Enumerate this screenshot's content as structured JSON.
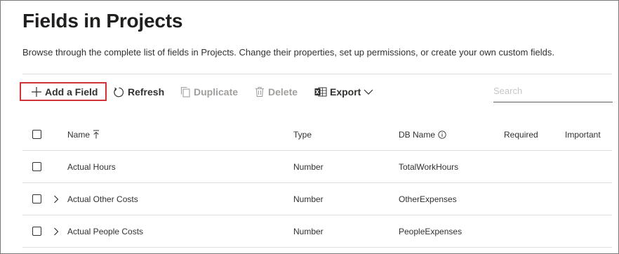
{
  "page": {
    "title": "Fields in Projects",
    "description": "Browse through the complete list of fields in Projects. Change their properties, set up permissions, or create your own custom fields."
  },
  "toolbar": {
    "add_label": "Add a Field",
    "refresh_label": "Refresh",
    "duplicate_label": "Duplicate",
    "delete_label": "Delete",
    "export_label": "Export",
    "search_placeholder": "Search"
  },
  "table": {
    "columns": {
      "name": "Name",
      "type": "Type",
      "db_name": "DB Name",
      "required": "Required",
      "important": "Important"
    },
    "rows": [
      {
        "name": "Actual Hours",
        "type": "Number",
        "db_name": "TotalWorkHours",
        "expandable": false
      },
      {
        "name": "Actual Other Costs",
        "type": "Number",
        "db_name": "OtherExpenses",
        "expandable": true
      },
      {
        "name": "Actual People Costs",
        "type": "Number",
        "db_name": "PeopleExpenses",
        "expandable": true
      }
    ]
  },
  "icons": {
    "add": "plus-icon",
    "refresh": "refresh-icon",
    "duplicate": "copy-icon",
    "delete": "trash-icon",
    "export": "excel-icon",
    "sort": "sort-ascending-icon",
    "info": "info-icon",
    "expand": "chevron-right-icon"
  },
  "colors": {
    "highlight_border": "#d13438",
    "text_primary": "#323130",
    "text_disabled": "#a19f9d",
    "excel_green": "#1d6f42"
  }
}
